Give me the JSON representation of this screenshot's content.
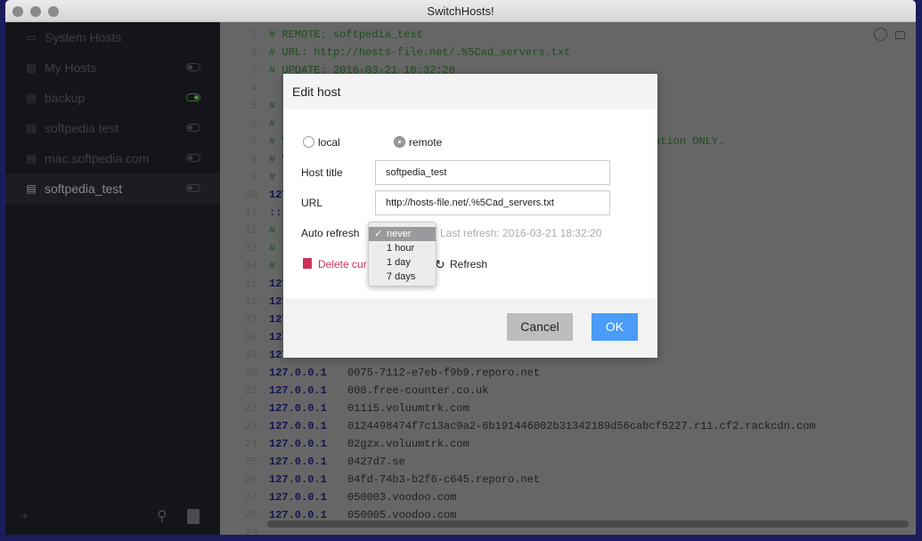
{
  "window": {
    "title": "SwitchHosts!"
  },
  "sidebar": {
    "items": [
      {
        "label": "System Hosts",
        "icon": "monitor-icon",
        "toggle": null
      },
      {
        "label": "My Hosts",
        "icon": "document-icon",
        "toggle": false
      },
      {
        "label": "backup",
        "icon": "document-icon",
        "toggle": true
      },
      {
        "label": "softpedia test",
        "icon": "document-icon",
        "toggle": false
      },
      {
        "label": "mac.softpedia.com",
        "icon": "document-icon",
        "toggle": false
      },
      {
        "label": "softpedia_test",
        "icon": "document-icon",
        "toggle": false,
        "active": true
      }
    ],
    "add_label": "+"
  },
  "editor": {
    "lines": [
      {
        "n": "1",
        "t": "cm",
        "c": "# REMOTE: softpedia_test"
      },
      {
        "n": "2",
        "t": "cm",
        "c": "# URL: http://hosts-file.net/.%5Cad_servers.txt"
      },
      {
        "n": "3",
        "t": "cm",
        "c": "# UPDATE: 2016-03-21 18:32:20"
      },
      {
        "n": "4",
        "t": "cm",
        "c": ""
      },
      {
        "n": "5",
        "t": "cm",
        "c": "# "
      },
      {
        "n": "6",
        "t": "cm",
        "c": "#"
      },
      {
        "n": "7",
        "t": "cm",
        "c": "# V                                             TS classification ONLY."
      },
      {
        "n": "8",
        "t": "cm",
        "c": "# V"
      },
      {
        "n": "9",
        "t": "cm",
        "c": "#"
      },
      {
        "n": "10",
        "t": "ip",
        "c": "127"
      },
      {
        "n": "11",
        "t": "ip",
        "c": "::"
      },
      {
        "n": "12",
        "t": "cm",
        "c": "#"
      },
      {
        "n": "13",
        "t": "cm",
        "c": "#"
      },
      {
        "n": "14",
        "t": "cm",
        "c": "#"
      },
      {
        "n": "15",
        "t": "ip",
        "c": "127"
      },
      {
        "n": "16",
        "t": "ip",
        "c": "127"
      },
      {
        "n": "17",
        "t": "ip",
        "c": "127"
      },
      {
        "n": "18",
        "t": "ip",
        "c": "127"
      },
      {
        "n": "19",
        "t": "ip",
        "c": "127"
      },
      {
        "n": "20",
        "ip": "127.0.0.1",
        "host": "0075-7112-e7eb-f9b9.reporo.net"
      },
      {
        "n": "21",
        "ip": "127.0.0.1",
        "host": "008.free-counter.co.uk"
      },
      {
        "n": "22",
        "ip": "127.0.0.1",
        "host": "011i5.voluumtrk.com"
      },
      {
        "n": "23",
        "ip": "127.0.0.1",
        "host": "0124498474f7c13ac9a2-6b191446002b31342189d56cabcf5227.r11.cf2.rackcdn.com"
      },
      {
        "n": "24",
        "ip": "127.0.0.1",
        "host": "02gzx.voluumtrk.com"
      },
      {
        "n": "25",
        "ip": "127.0.0.1",
        "host": "0427d7.se"
      },
      {
        "n": "26",
        "ip": "127.0.0.1",
        "host": "04fd-74b3-b2f6-c645.reporo.net"
      },
      {
        "n": "27",
        "ip": "127.0.0.1",
        "host": "050003.voodoo.com"
      },
      {
        "n": "28",
        "ip": "127.0.0.1",
        "host": "050005.voodoo.com"
      },
      {
        "n": "29",
        "t": "cm",
        "c": ""
      }
    ]
  },
  "dialog": {
    "title": "Edit host",
    "type_options": {
      "local": "local",
      "remote": "remote",
      "selected": "remote"
    },
    "host_title_label": "Host title",
    "host_title_value": "softpedia_test",
    "url_label": "URL",
    "url_value": "http://hosts-file.net/.%5Cad_servers.txt",
    "auto_refresh_label": "Auto refresh",
    "auto_refresh_options": [
      "never",
      "1 hour",
      "1 day",
      "7 days"
    ],
    "auto_refresh_selected": "never",
    "last_refresh": "Last refresh: 2016-03-21 18:32:20",
    "delete_label": "Delete cur",
    "refresh_label": "Refresh",
    "cancel_label": "Cancel",
    "ok_label": "OK",
    "colors": {
      "ok": "#4a9cf8",
      "delete": "#d0305a"
    }
  }
}
